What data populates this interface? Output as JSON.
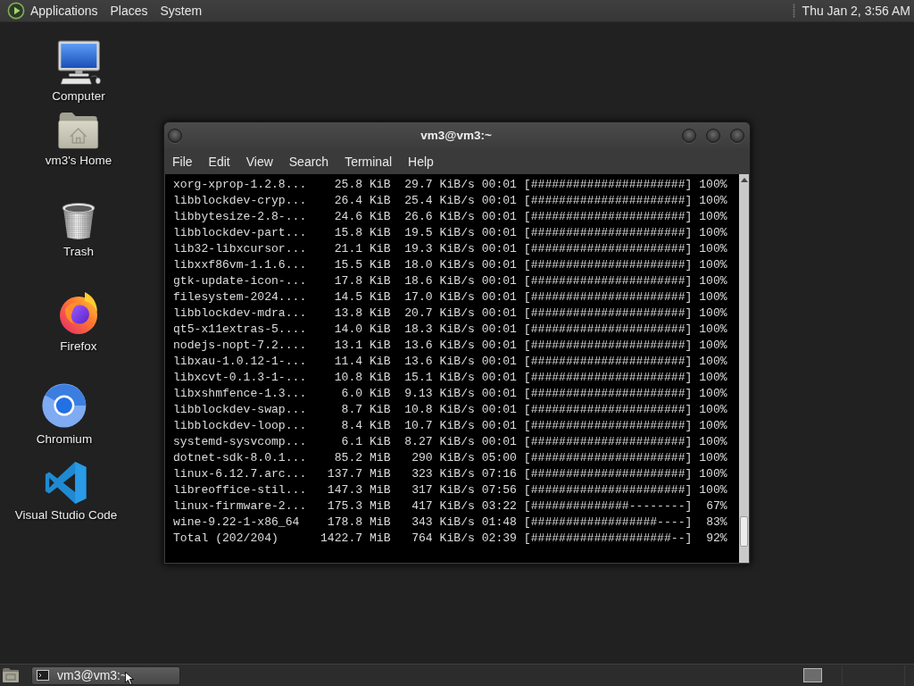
{
  "top_panel": {
    "menus": [
      "Applications",
      "Places",
      "System"
    ],
    "clock": "Thu Jan 2, 3:56 AM"
  },
  "desktop_icons": [
    {
      "label": "Computer",
      "kind": "computer"
    },
    {
      "label": "vm3's Home",
      "kind": "home"
    },
    {
      "label": "Trash",
      "kind": "trash"
    },
    {
      "label": "Firefox",
      "kind": "firefox"
    },
    {
      "label": "Chromium",
      "kind": "chromium"
    },
    {
      "label": "Visual Studio Code",
      "kind": "vscode"
    }
  ],
  "terminal": {
    "title": "vm3@vm3:~",
    "menu": [
      "File",
      "Edit",
      "View",
      "Search",
      "Terminal",
      "Help"
    ],
    "rows": [
      {
        "name": "xorg-xprop-1.2.8...",
        "size": "25.8 KiB",
        "rate": "29.7 KiB/s",
        "eta": "00:01",
        "bar": "[######################]",
        "percent": "100%"
      },
      {
        "name": "libblockdev-cryp...",
        "size": "26.4 KiB",
        "rate": "25.4 KiB/s",
        "eta": "00:01",
        "bar": "[######################]",
        "percent": "100%"
      },
      {
        "name": "libbytesize-2.8-...",
        "size": "24.6 KiB",
        "rate": "26.6 KiB/s",
        "eta": "00:01",
        "bar": "[######################]",
        "percent": "100%"
      },
      {
        "name": "libblockdev-part...",
        "size": "15.8 KiB",
        "rate": "19.5 KiB/s",
        "eta": "00:01",
        "bar": "[######################]",
        "percent": "100%"
      },
      {
        "name": "lib32-libxcursor...",
        "size": "21.1 KiB",
        "rate": "19.3 KiB/s",
        "eta": "00:01",
        "bar": "[######################]",
        "percent": "100%"
      },
      {
        "name": "libxxf86vm-1.1.6...",
        "size": "15.5 KiB",
        "rate": "18.0 KiB/s",
        "eta": "00:01",
        "bar": "[######################]",
        "percent": "100%"
      },
      {
        "name": "gtk-update-icon-...",
        "size": "17.8 KiB",
        "rate": "18.6 KiB/s",
        "eta": "00:01",
        "bar": "[######################]",
        "percent": "100%"
      },
      {
        "name": "filesystem-2024....",
        "size": "14.5 KiB",
        "rate": "17.0 KiB/s",
        "eta": "00:01",
        "bar": "[######################]",
        "percent": "100%"
      },
      {
        "name": "libblockdev-mdra...",
        "size": "13.8 KiB",
        "rate": "20.7 KiB/s",
        "eta": "00:01",
        "bar": "[######################]",
        "percent": "100%"
      },
      {
        "name": "qt5-x11extras-5....",
        "size": "14.0 KiB",
        "rate": "18.3 KiB/s",
        "eta": "00:01",
        "bar": "[######################]",
        "percent": "100%"
      },
      {
        "name": "nodejs-nopt-7.2....",
        "size": "13.1 KiB",
        "rate": "13.6 KiB/s",
        "eta": "00:01",
        "bar": "[######################]",
        "percent": "100%"
      },
      {
        "name": "libxau-1.0.12-1-...",
        "size": "11.4 KiB",
        "rate": "13.6 KiB/s",
        "eta": "00:01",
        "bar": "[######################]",
        "percent": "100%"
      },
      {
        "name": "libxcvt-0.1.3-1-...",
        "size": "10.8 KiB",
        "rate": "15.1 KiB/s",
        "eta": "00:01",
        "bar": "[######################]",
        "percent": "100%"
      },
      {
        "name": "libxshmfence-1.3...",
        "size": "6.0 KiB",
        "rate": "9.13 KiB/s",
        "eta": "00:01",
        "bar": "[######################]",
        "percent": "100%"
      },
      {
        "name": "libblockdev-swap...",
        "size": "8.7 KiB",
        "rate": "10.8 KiB/s",
        "eta": "00:01",
        "bar": "[######################]",
        "percent": "100%"
      },
      {
        "name": "libblockdev-loop...",
        "size": "8.4 KiB",
        "rate": "10.7 KiB/s",
        "eta": "00:01",
        "bar": "[######################]",
        "percent": "100%"
      },
      {
        "name": "systemd-sysvcomp...",
        "size": "6.1 KiB",
        "rate": "8.27 KiB/s",
        "eta": "00:01",
        "bar": "[######################]",
        "percent": "100%"
      },
      {
        "name": "dotnet-sdk-8.0.1...",
        "size": "85.2 MiB",
        "rate": "290 KiB/s",
        "eta": "05:00",
        "bar": "[######################]",
        "percent": "100%"
      },
      {
        "name": "linux-6.12.7.arc...",
        "size": "137.7 MiB",
        "rate": "323 KiB/s",
        "eta": "07:16",
        "bar": "[######################]",
        "percent": "100%"
      },
      {
        "name": "libreoffice-stil...",
        "size": "147.3 MiB",
        "rate": "317 KiB/s",
        "eta": "07:56",
        "bar": "[######################]",
        "percent": "100%"
      },
      {
        "name": "linux-firmware-2...",
        "size": "175.3 MiB",
        "rate": "417 KiB/s",
        "eta": "03:22",
        "bar": "[##############--------]",
        "percent": "67%"
      },
      {
        "name": "wine-9.22-1-x86_64",
        "size": "178.8 MiB",
        "rate": "343 KiB/s",
        "eta": "01:48",
        "bar": "[##################----]",
        "percent": "83%"
      },
      {
        "name": "Total (202/204)",
        "size": "1422.7 MiB",
        "rate": "764 KiB/s",
        "eta": "02:39",
        "bar": "[####################--]",
        "percent": "92%"
      }
    ]
  },
  "taskbar": {
    "tasks": [
      {
        "label": "vm3@vm3:~",
        "selected": true
      }
    ]
  }
}
